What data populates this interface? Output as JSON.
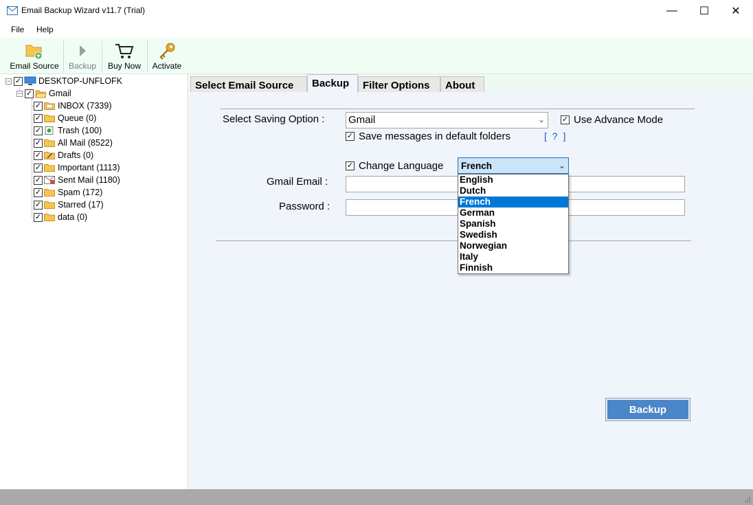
{
  "window": {
    "title": "Email Backup Wizard v11.7 (Trial)",
    "minimize": "—",
    "maximize": "☐",
    "close": "✕"
  },
  "menu": {
    "file": "File",
    "help": "Help"
  },
  "toolbar": {
    "email_source": "Email Source",
    "backup": "Backup",
    "buy_now": "Buy Now",
    "activate": "Activate"
  },
  "tree": {
    "root": "DESKTOP-UNFLOFK",
    "account": "Gmail",
    "folders": [
      {
        "label": "INBOX (7339)",
        "icon": "inbox-folder-icon"
      },
      {
        "label": "Queue (0)",
        "icon": "folder-icon"
      },
      {
        "label": "Trash (100)",
        "icon": "trash-folder-icon"
      },
      {
        "label": "All Mail (8522)",
        "icon": "folder-icon"
      },
      {
        "label": "Drafts (0)",
        "icon": "drafts-folder-icon"
      },
      {
        "label": "Important (1113)",
        "icon": "folder-icon"
      },
      {
        "label": "Sent Mail (1180)",
        "icon": "sent-folder-icon"
      },
      {
        "label": "Spam (172)",
        "icon": "folder-icon"
      },
      {
        "label": "Starred (17)",
        "icon": "folder-icon"
      },
      {
        "label": "data (0)",
        "icon": "folder-icon"
      }
    ]
  },
  "tabs": {
    "select_source": "Select Email Source",
    "backup": "Backup",
    "filter": "Filter Options",
    "about": "About"
  },
  "form": {
    "saving_option_label": "Select Saving Option :",
    "saving_option_value": "Gmail",
    "advance_mode": "Use Advance Mode",
    "default_folders": "Save messages in default folders",
    "help_link": "[ ? ]",
    "change_language": "Change Language",
    "language_value": "French",
    "email_label": "Gmail Email :",
    "email_value": "",
    "password_label": "Password :",
    "password_value": "",
    "checkmark": "✓"
  },
  "languages": [
    "English",
    "Dutch",
    "French",
    "German",
    "Spanish",
    "Swedish",
    "Norwegian",
    "Italy",
    "Finnish"
  ],
  "backup_button": "Backup"
}
